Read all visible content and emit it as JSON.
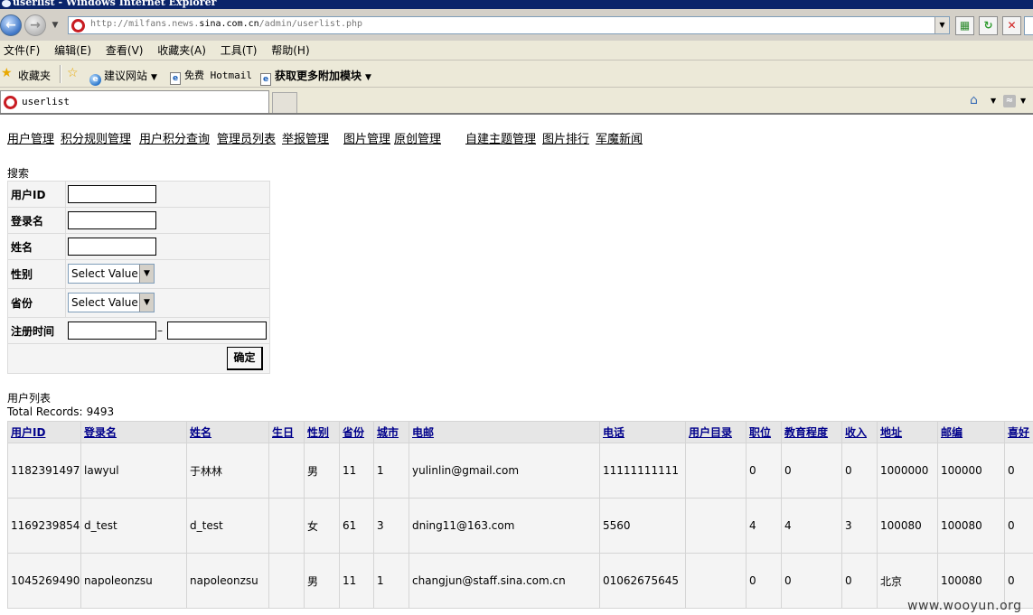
{
  "browser": {
    "window_title": "userlist - Windows Internet Explorer",
    "url_prefix": "http://milfans.news.",
    "url_domain": "sina.com.cn",
    "url_path": "/admin/userlist.php",
    "menu": [
      "文件(F)",
      "编辑(E)",
      "查看(V)",
      "收藏夹(A)",
      "工具(T)",
      "帮助(H)"
    ],
    "favorites_label": "收藏夹",
    "fav_items": {
      "suggested": "建议网站",
      "hotmail": "免费 Hotmail",
      "addons": "获取更多附加模块"
    },
    "tab_title": "userlist"
  },
  "page": {
    "nav_links": [
      "用户管理",
      "积分规则管理",
      "用户积分查询",
      "管理员列表",
      "举报管理",
      "图片管理",
      "原创管理",
      "自建主题管理",
      "图片排行",
      "军魔新闻"
    ],
    "search": {
      "title": "搜索",
      "labels": {
        "user_id": "用户ID",
        "login": "登录名",
        "name": "姓名",
        "gender": "性别",
        "province": "省份",
        "reg_time": "注册时间"
      },
      "gender_value": "Select Value",
      "province_value": "Select Value",
      "submit": "确定"
    },
    "list": {
      "title": "用户列表",
      "total_label": "Total Records:",
      "total_value": "9493",
      "headers": [
        "用户ID",
        "登录名",
        "姓名",
        "生日",
        "性别",
        "省份",
        "城市",
        "电邮",
        "电话",
        "用户目录",
        "职位",
        "教育程度",
        "收入",
        "地址",
        "邮编",
        "喜好"
      ],
      "rows": [
        [
          "1182391497",
          "lawyul",
          "于林林",
          "",
          "男",
          "11",
          "1",
          "yulinlin@gmail.com",
          "11111111111",
          "",
          "0",
          "0",
          "0",
          "1000000",
          "100000",
          "0"
        ],
        [
          "1169239854",
          "d_test",
          "d_test",
          "",
          "女",
          "61",
          "3",
          "dning11@163.com",
          "5560",
          "",
          "4",
          "4",
          "3",
          "100080",
          "100080",
          "0"
        ],
        [
          "1045269490",
          "napoleonzsu",
          "napoleonzsu",
          "",
          "男",
          "11",
          "1",
          "changjun@staff.sina.com.cn",
          "01062675645",
          "",
          "0",
          "0",
          "0",
          "北京",
          "100080",
          "0"
        ]
      ]
    }
  },
  "watermark": "www.wooyun.org"
}
